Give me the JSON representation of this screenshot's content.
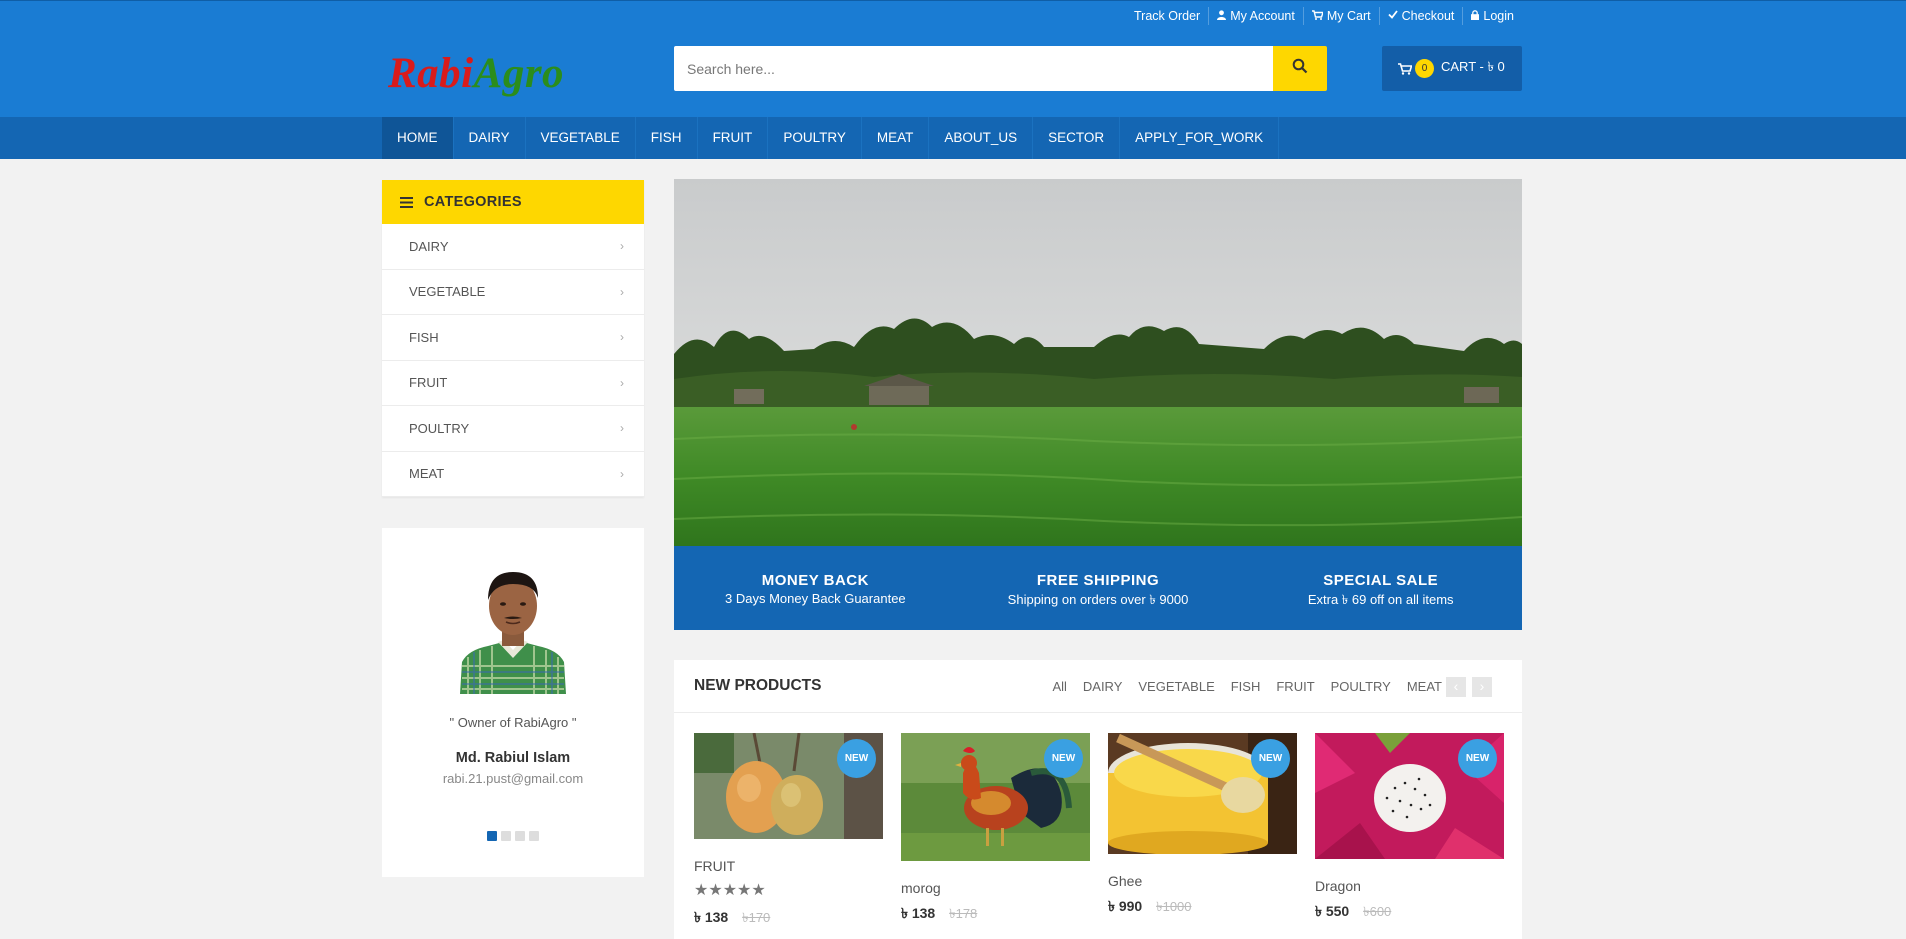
{
  "top_links": [
    {
      "label": "Track Order",
      "icon": "none"
    },
    {
      "label": "My Account",
      "icon": "user-icon"
    },
    {
      "label": "My Cart",
      "icon": "cart-icon"
    },
    {
      "label": "Checkout",
      "icon": "check-icon"
    },
    {
      "label": "Login",
      "icon": "lock-icon"
    }
  ],
  "brand": {
    "part1": "Rabi",
    "part2": "Agro"
  },
  "search": {
    "placeholder": "Search here..."
  },
  "cart": {
    "count": "0",
    "label": "CART - ৳ 0"
  },
  "nav": [
    "HOME",
    "DAIRY",
    "VEGETABLE",
    "FISH",
    "FRUIT",
    "POULTRY",
    "MEAT",
    "ABOUT_US",
    "SECTOR",
    "APPLY_FOR_WORK"
  ],
  "sidebar": {
    "title": "CATEGORIES",
    "items": [
      "DAIRY",
      "VEGETABLE",
      "FISH",
      "FRUIT",
      "POULTRY",
      "MEAT"
    ]
  },
  "owner": {
    "role": "\" Owner of RabiAgro \"",
    "name": "Md. Rabiul Islam",
    "email": "rabi.21.pust@gmail.com"
  },
  "features": [
    {
      "title": "MONEY BACK",
      "sub": "3 Days Money Back Guarantee"
    },
    {
      "title": "FREE SHIPPING",
      "sub": "Shipping on orders over ৳ 9000"
    },
    {
      "title": "SPECIAL SALE",
      "sub": "Extra ৳ 69 off on all items"
    }
  ],
  "new_products": {
    "title": "NEW PRODUCTS",
    "tabs": [
      "All",
      "DAIRY",
      "VEGETABLE",
      "FISH",
      "FRUIT",
      "POULTRY",
      "MEAT"
    ],
    "items": [
      {
        "name": "FRUIT",
        "badge": "NEW",
        "stars": "★★★★★",
        "price": "৳ 138",
        "old_price": "৳170"
      },
      {
        "name": "morog",
        "badge": "NEW",
        "price": "৳ 138",
        "old_price": "৳178"
      },
      {
        "name": "Ghee",
        "badge": "NEW",
        "price": "৳ 990",
        "old_price": "৳1000"
      },
      {
        "name": "Dragon",
        "badge": "NEW",
        "price": "৳ 550",
        "old_price": "৳600"
      }
    ]
  },
  "colors": {
    "header": "#1a7cd3",
    "nav": "#1466b3",
    "accent": "#fed700",
    "badge": "#3aa0e2"
  }
}
